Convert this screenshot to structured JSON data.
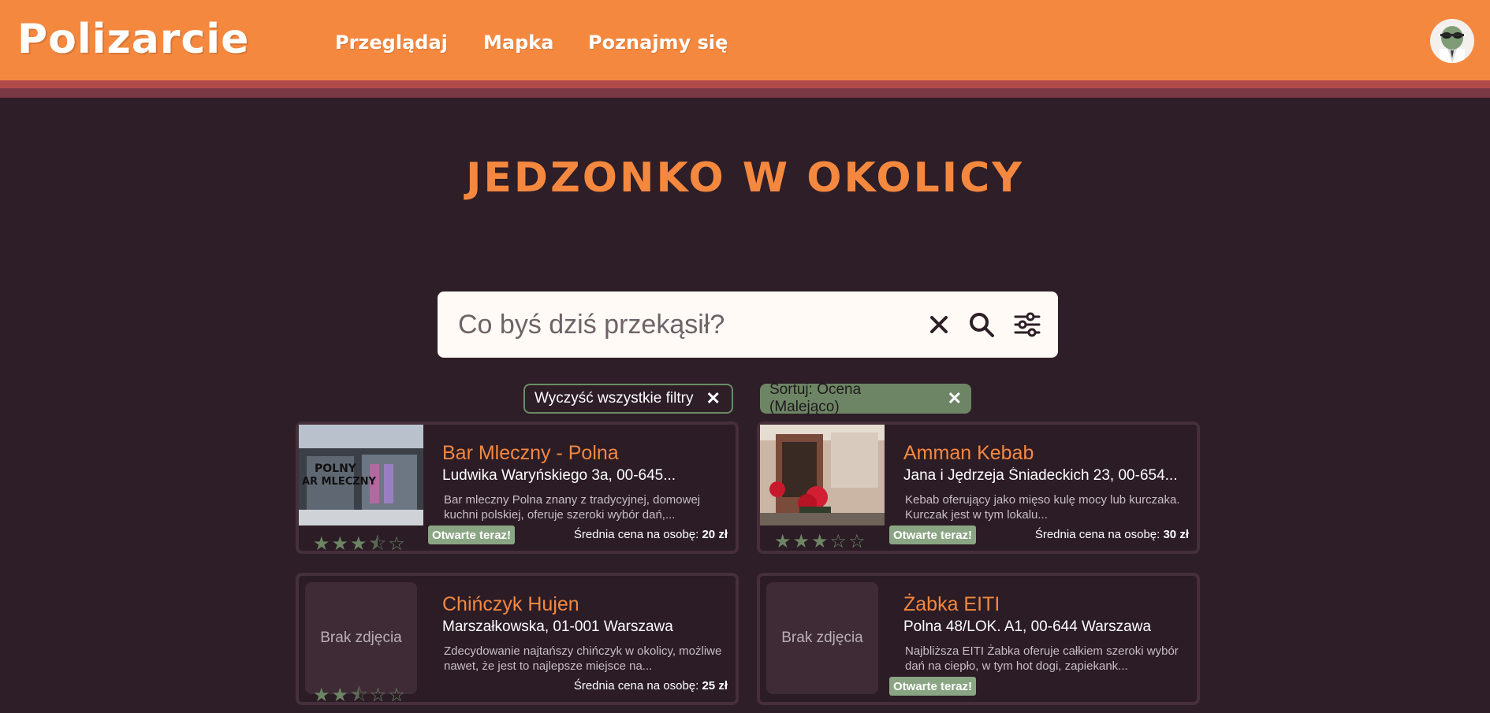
{
  "header": {
    "logo": "Polizarcie",
    "nav": [
      "Przeglądaj",
      "Mapka",
      "Poznajmy się"
    ]
  },
  "page_title": "JEDZONKO W OKOLICY",
  "search": {
    "placeholder": "Co byś dziś przekąsił?"
  },
  "chips": {
    "clear_label": "Wyczyść wszystkie filtry",
    "sort_label": "Sortuj: Ocena (Malejąco)"
  },
  "price_label": "Średnia cena na osobę:",
  "open_label": "Otwarte teraz!",
  "no_photo_label": "Brak zdjęcia",
  "places": [
    {
      "name": "Bar Mleczny - Polna",
      "address": "Ludwika Waryńskiego 3a, 00-645...",
      "description": "Bar mleczny Polna znany z tradycyjnej, domowej kuchni polskiej, oferuje szeroki wybór dań,...",
      "rating": 3.5,
      "open": true,
      "price": "20 zł",
      "has_photo": true
    },
    {
      "name": "Amman Kebab",
      "address": "Jana i Jędrzeja Śniadeckich 23, 00-654...",
      "description": "Kebab oferujący jako mięso kulę mocy lub kurczaka. Kurczak jest w tym lokalu...",
      "rating": 3,
      "open": true,
      "price": "30 zł",
      "has_photo": true
    },
    {
      "name": "Chińczyk Hujen",
      "address": "Marszałkowska, 01-001 Warszawa",
      "description": "Zdecydowanie najtańszy chińczyk w okolicy, możliwe nawet, że jest to najlepsze miejsce na...",
      "rating": 2.5,
      "open": false,
      "price": "25 zł",
      "has_photo": false
    },
    {
      "name": "Żabka EITI",
      "address": "Polna 48/LOK. A1, 00-644 Warszawa",
      "description": "Najbliższa EITI Żabka oferuje całkiem szeroki wybór dań na ciepło, w tym hot dogi, zapiekank...",
      "rating": 0,
      "open": true,
      "price": "",
      "has_photo": false
    }
  ],
  "colors": {
    "accent": "#f5883f",
    "background": "#2e1e27",
    "green": "#6d8565"
  }
}
